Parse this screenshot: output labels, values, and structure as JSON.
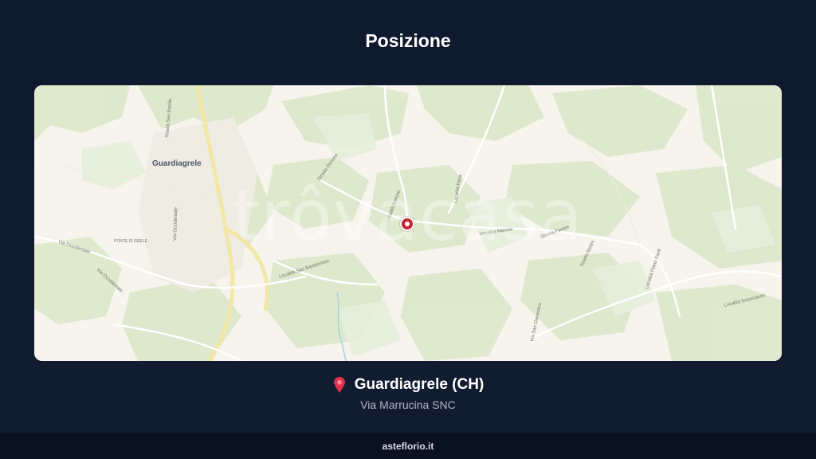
{
  "header": {
    "title": "Posizione"
  },
  "map": {
    "watermark": "trôvacasa",
    "labels": {
      "town": "Guardiagrele",
      "via_occidentale_1": "Via Occidentale",
      "via_occidentale_2": "Via Occidentale",
      "ponte_di_grele": "PONTE DI GRELE",
      "localita_san_bartolomeo": "Località San Bartolomeo",
      "strada_ossona": "Strada Ossona",
      "localita_melone_1": "Località Melone",
      "localita_melone_2": "Località Melone",
      "localita_feria": "Località Feria",
      "strada_pavoni": "Strada Pavoni",
      "strada_bellini": "Strada Bellini",
      "via_san_domenico": "Via San Domenico",
      "localita_piano_fanti": "Località Piano Fanti",
      "localita_sciusciardo": "Località Sciusciardo",
      "via_occidentale_vert": "Via Occidentale",
      "strada_san_basilio": "Strada San Basilio"
    },
    "colors": {
      "land": "#f6f4ec",
      "forest": "#dde8cf",
      "road": "#f2e6a8",
      "water": "#a9cfe0",
      "marker": "#c82333"
    }
  },
  "location": {
    "icon": "map-pin-icon",
    "name": "Guardiagrele (CH)",
    "address": "Via Marrucina SNC"
  },
  "footer": {
    "brand": "asteflorio.it"
  }
}
